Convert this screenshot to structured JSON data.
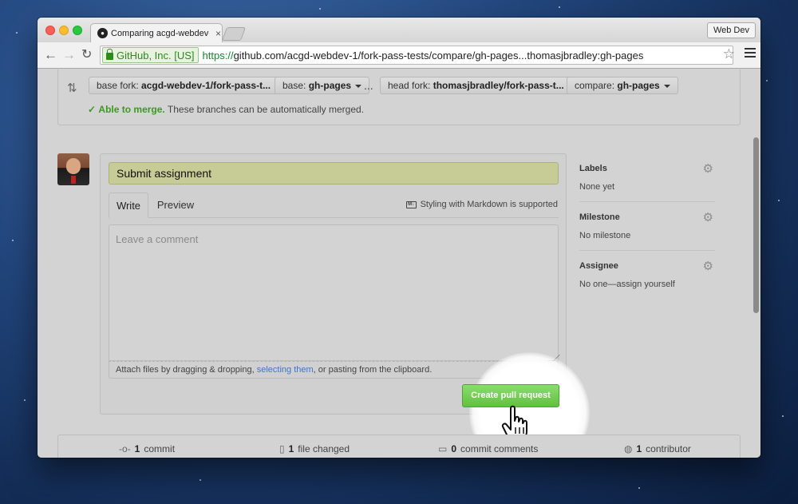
{
  "browser": {
    "tab_title": "Comparing acgd-webdev-1...",
    "profile": "Web Dev",
    "ev_badge": "GitHub, Inc. [US]",
    "url_scheme": "https://",
    "url_rest": "github.com/acgd-webdev-1/fork-pass-tests/compare/gh-pages...thomasjbradley:gh-pages"
  },
  "compare": {
    "base_fork_label": "base fork:",
    "base_fork_value": "acgd-webdev-1/fork-pass-t...",
    "base_label": "base:",
    "base_value": "gh-pages",
    "separator": "...",
    "head_fork_label": "head fork:",
    "head_fork_value": "thomasjbradley/fork-pass-t...",
    "compare_label": "compare:",
    "compare_value": "gh-pages",
    "merge_status": "Able to merge.",
    "merge_message": "These branches can be automatically merged."
  },
  "form": {
    "title_value": "Submit assignment",
    "tab_write": "Write",
    "tab_preview": "Preview",
    "markdown_hint": "Styling with Markdown is supported",
    "comment_placeholder": "Leave a comment",
    "attach_prefix": "Attach files by dragging & dropping, ",
    "attach_link": "selecting them",
    "attach_suffix": ", or pasting from the clipboard.",
    "submit_label": "Create pull request"
  },
  "sidebar": {
    "sections": [
      {
        "title": "Labels",
        "value": "None yet"
      },
      {
        "title": "Milestone",
        "value": "No milestone"
      },
      {
        "title": "Assignee",
        "value": "No one—assign yourself"
      }
    ]
  },
  "stats": {
    "commits_count": "1",
    "commits_label": "commit",
    "files_count": "1",
    "files_label": "file changed",
    "comments_count": "0",
    "comments_label": "commit comments",
    "contributors_count": "1",
    "contributors_label": "contributor"
  },
  "colors": {
    "success": "#3a9a1f",
    "button_green": "#62c03f",
    "link": "#4075c7",
    "title_input_bg": "#c7cb95"
  },
  "icons": [
    "github-icon",
    "back-icon",
    "forward-icon",
    "reload-icon",
    "lock-icon",
    "bookmark-star-icon",
    "menu-icon",
    "compare-arrows-icon",
    "check-icon",
    "markdown-icon",
    "gear-icon",
    "commit-icon",
    "file-icon",
    "comment-icon",
    "contributor-icon",
    "hand-cursor-icon"
  ]
}
